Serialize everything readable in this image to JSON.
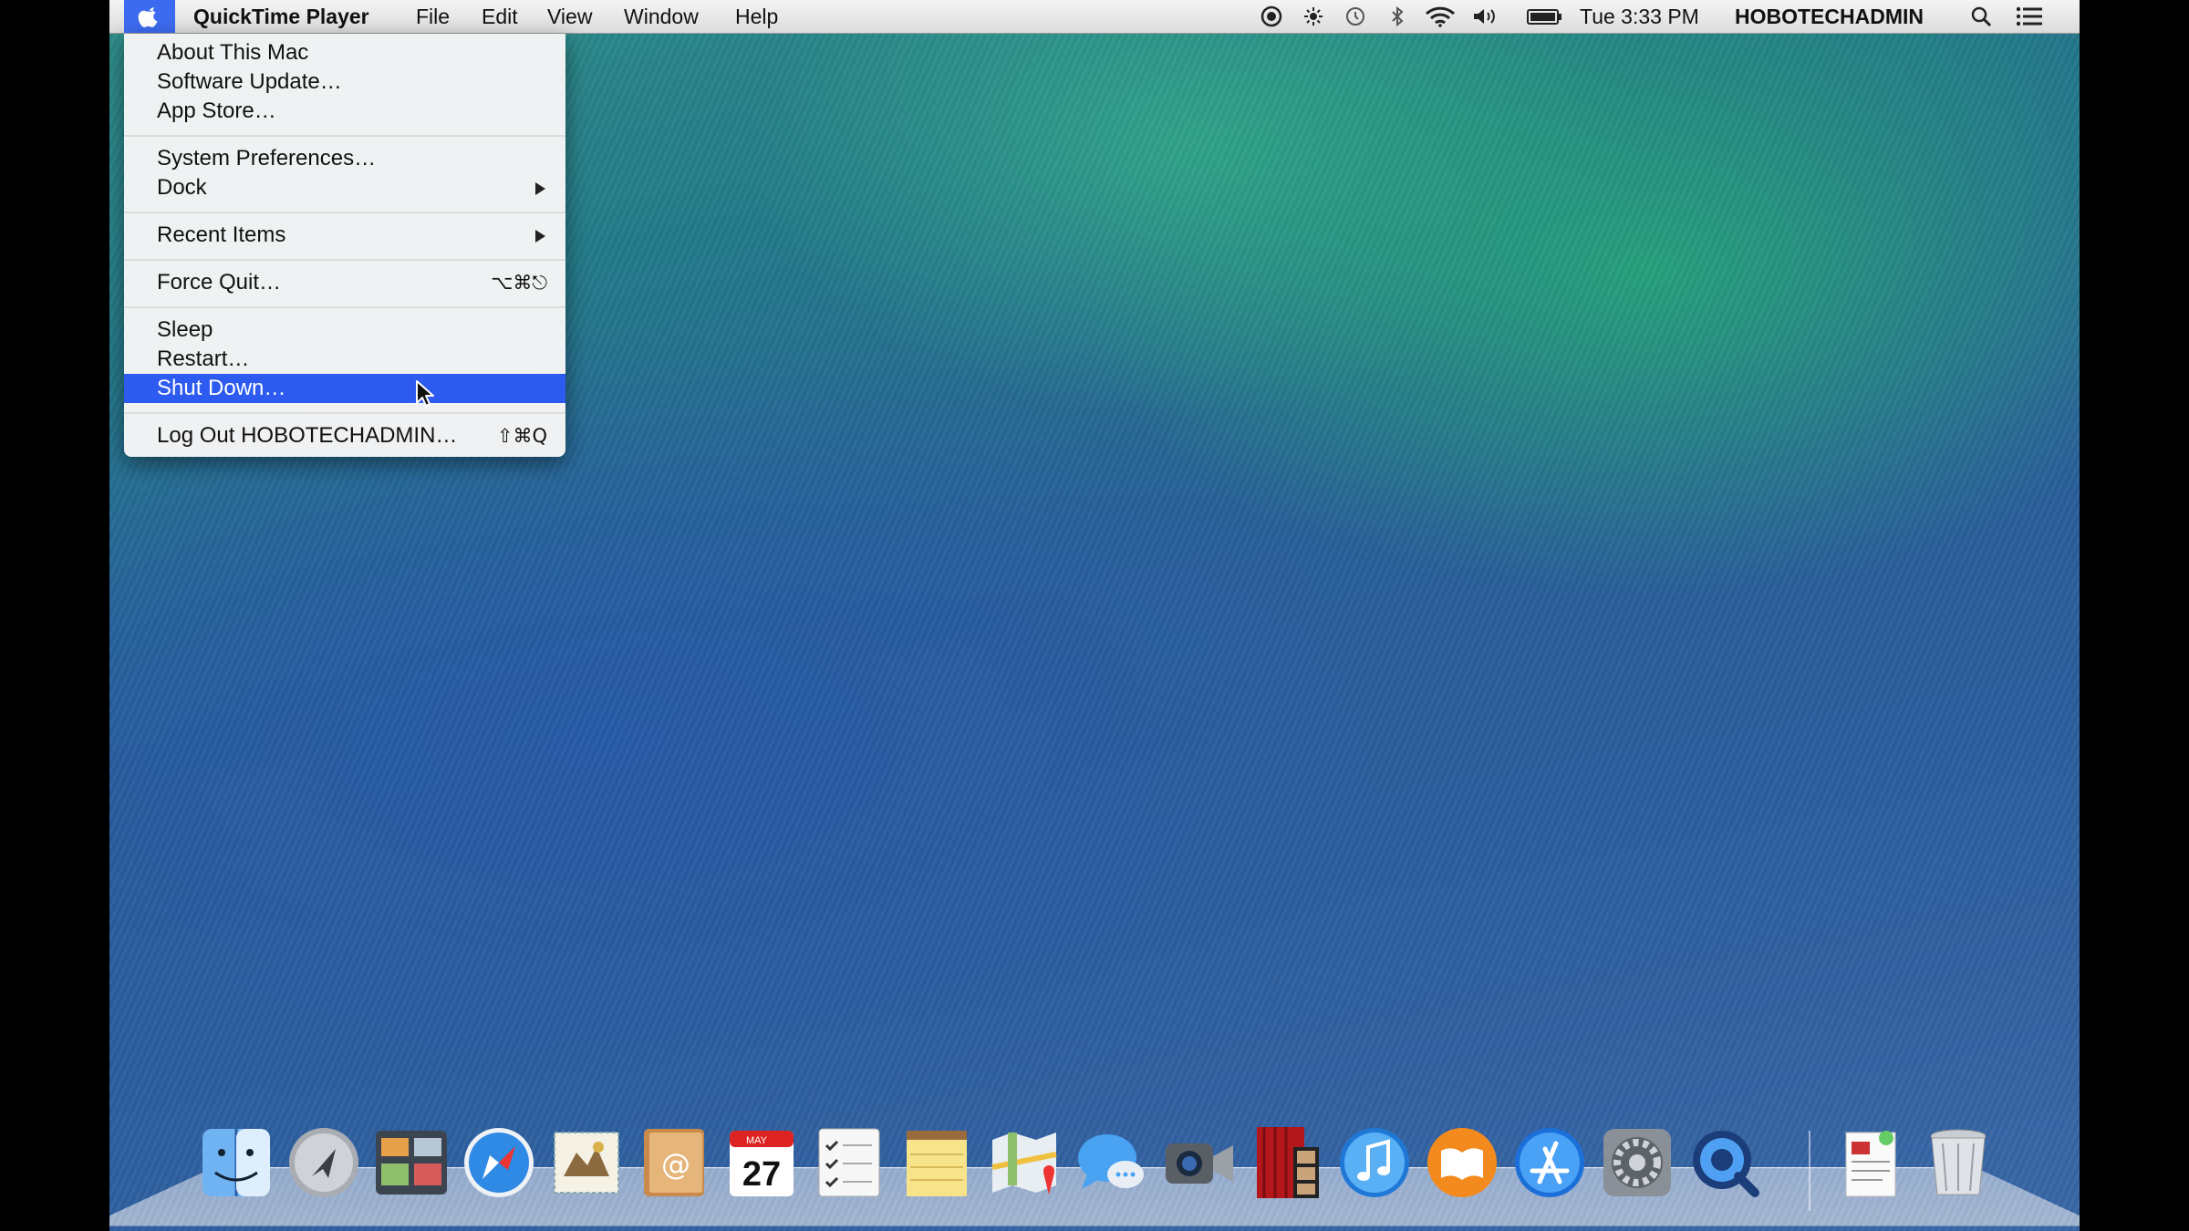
{
  "menubar": {
    "app_name": "QuickTime Player",
    "menus": [
      "File",
      "Edit",
      "View",
      "Window",
      "Help"
    ],
    "clock": "Tue 3:33 PM",
    "user": "HOBOTECHADMIN",
    "status_icons": [
      "screen-record-icon",
      "brightness-icon",
      "time-machine-icon",
      "bluetooth-icon",
      "wifi-icon",
      "volume-icon",
      "battery-icon",
      "spotlight-search-icon",
      "notification-center-icon"
    ]
  },
  "apple_menu": {
    "items": [
      {
        "label": "About This Mac",
        "shortcut": ""
      },
      {
        "label": "Software Update…",
        "shortcut": ""
      },
      {
        "label": "App Store…",
        "shortcut": ""
      },
      {
        "label": "System Preferences…",
        "shortcut": ""
      },
      {
        "label": "Dock",
        "shortcut": ""
      },
      {
        "label": "Recent Items",
        "shortcut": ""
      },
      {
        "label": "Force Quit…",
        "shortcut": "⌥⌘⎋"
      },
      {
        "label": "Sleep",
        "shortcut": ""
      },
      {
        "label": "Restart…",
        "shortcut": ""
      },
      {
        "label": "Shut Down…",
        "shortcut": ""
      },
      {
        "label": "Log Out HOBOTECHADMIN…",
        "shortcut": "⇧⌘Q"
      }
    ],
    "selected_item": "Shut Down…"
  },
  "dock": {
    "calendar_month": "MAY",
    "calendar_day": "27",
    "apps": [
      "finder-icon",
      "launchpad-icon",
      "mission-control-icon",
      "safari-icon",
      "mail-icon",
      "contacts-icon",
      "calendar-icon",
      "reminders-icon",
      "notes-icon",
      "maps-icon",
      "messages-icon",
      "facetime-icon",
      "photo-booth-icon",
      "itunes-icon",
      "ibooks-icon",
      "app-store-icon",
      "system-preferences-icon",
      "quicktime-icon",
      "documents-stack-icon",
      "trash-icon"
    ]
  },
  "colors": {
    "menu_highlight": "#2d5bf0",
    "apple_menu_active": "#3d6bef"
  }
}
